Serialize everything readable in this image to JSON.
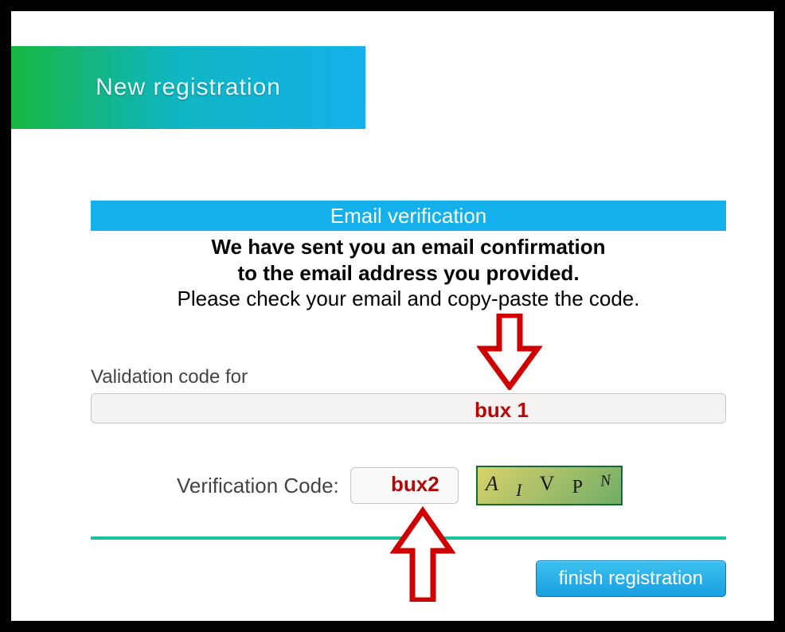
{
  "header": {
    "title": "New registration"
  },
  "section": {
    "title": "Email verification"
  },
  "message": {
    "line1": "We have sent you an email confirmation",
    "line2": "to the email address you provided.",
    "line3": "Please check your email and copy-paste the code."
  },
  "validation": {
    "label": "Validation code for",
    "value": ""
  },
  "verification": {
    "label": "Verification Code:",
    "value": ""
  },
  "captcha": {
    "chars": [
      "A",
      "I",
      "V",
      "P",
      "N"
    ]
  },
  "buttons": {
    "finish": "finish registration"
  },
  "annotations": {
    "bux1": "bux 1",
    "bux2": "bux2"
  },
  "colors": {
    "accent_blue": "#14b0eb",
    "accent_green": "#19c29a",
    "annotation_red": "#b40808"
  }
}
